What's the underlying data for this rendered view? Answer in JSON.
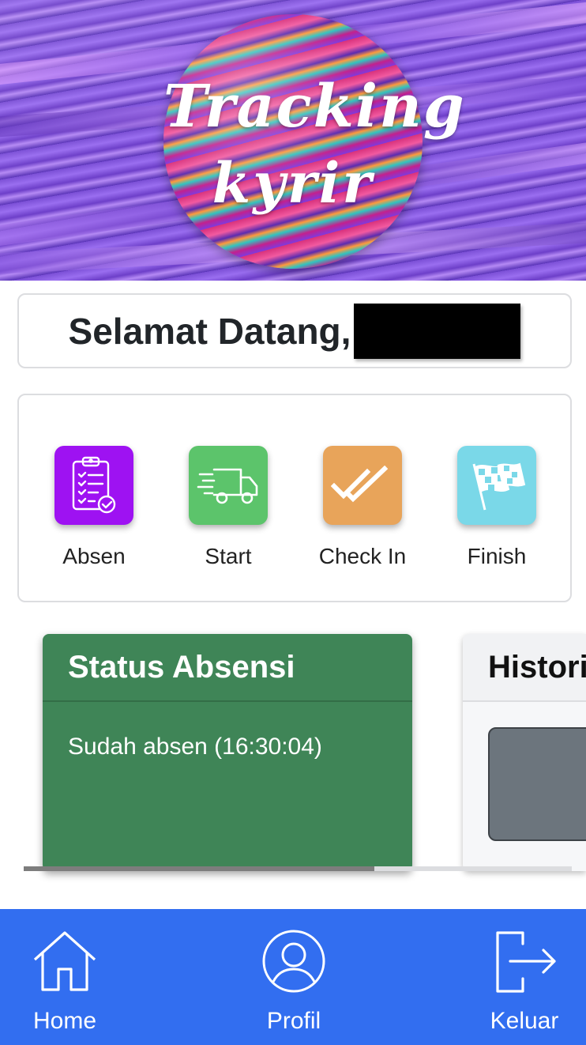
{
  "banner": {
    "logo_line1": "Tracking",
    "logo_line2": "kyrir"
  },
  "welcome": {
    "greeting": "Selamat Datang,"
  },
  "menu": {
    "items": [
      {
        "label": "Absen",
        "icon": "clipboard-check-icon",
        "color": "#9e12f2"
      },
      {
        "label": "Start",
        "icon": "delivery-truck-icon",
        "color": "#5cc46b"
      },
      {
        "label": "Check In",
        "icon": "double-check-icon",
        "color": "#e8a45a"
      },
      {
        "label": "Finish",
        "icon": "checkered-flag-icon",
        "color": "#7ad8e8"
      }
    ]
  },
  "status_card": {
    "title": "Status Absensi",
    "text": "Sudah absen (16:30:04)",
    "color": "#3f8557"
  },
  "history_card": {
    "title": "Histori"
  },
  "bottom_nav": {
    "color": "#326ef0",
    "items": [
      {
        "label": "Home",
        "icon": "home-icon"
      },
      {
        "label": "Profil",
        "icon": "user-circle-icon"
      },
      {
        "label": "Keluar",
        "icon": "logout-icon"
      }
    ]
  }
}
